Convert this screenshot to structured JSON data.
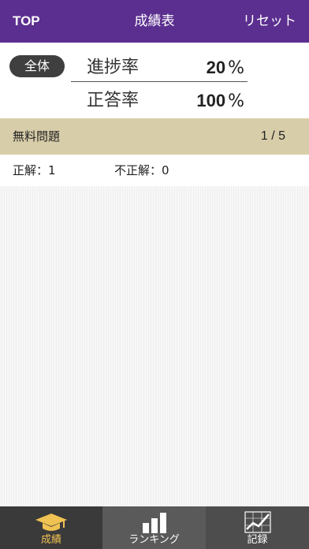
{
  "nav": {
    "left_label": "TOP",
    "title": "成績表",
    "right_label": "リセット"
  },
  "summary": {
    "scope": "全体",
    "progress_label": "進捗率",
    "progress_value": "20",
    "progress_unit": "%",
    "correct_rate_label": "正答率",
    "correct_rate_value": "100",
    "correct_rate_unit": "%"
  },
  "section": {
    "title": "無料問題",
    "count": "1 / 5"
  },
  "results": {
    "correct": "正解：1",
    "incorrect": "不正解：0"
  },
  "tabs": [
    {
      "label": "成績",
      "icon": "mortarboard-icon",
      "selected": true
    },
    {
      "label": "ランキング",
      "icon": "bar-chart-icon",
      "selected": false
    },
    {
      "label": "記録",
      "icon": "line-chart-icon",
      "selected": false
    }
  ],
  "colors": {
    "nav_bg": "#5b2f8f",
    "section_bg": "#d8cda9",
    "tab_active": "#f0c252"
  }
}
